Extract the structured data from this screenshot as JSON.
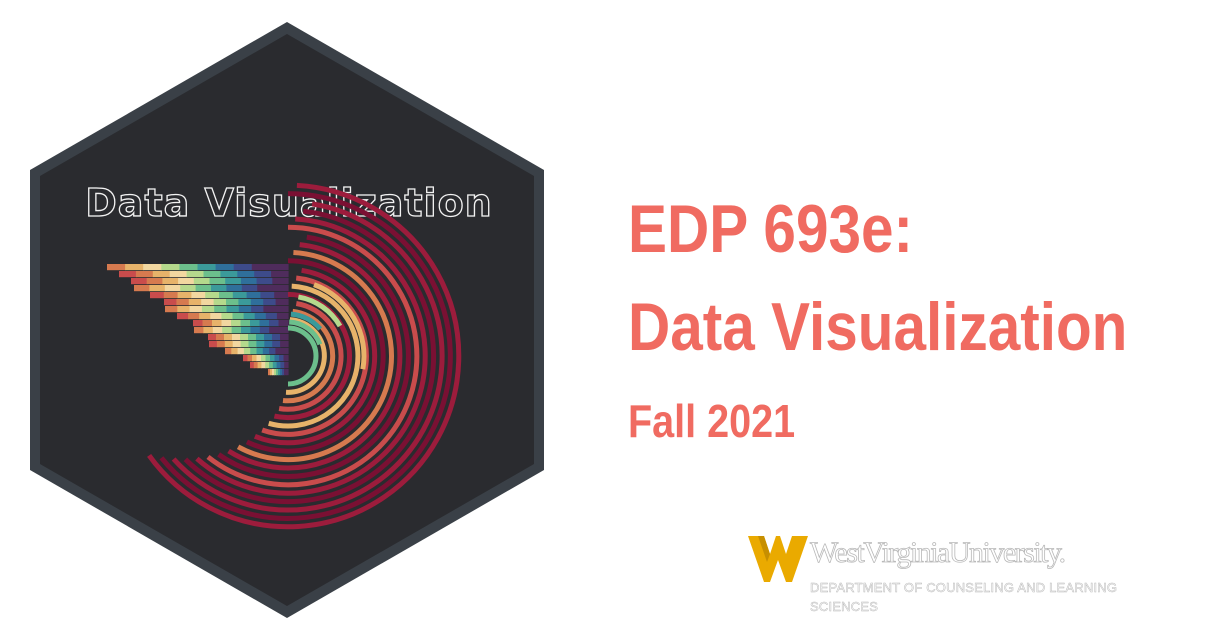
{
  "hex_sticker": {
    "title": "Data Visualization",
    "background_color": "#2a2b2f",
    "border_color": "#3a4047",
    "palette": [
      "#f2d7a0",
      "#e7b36a",
      "#d67a4f",
      "#c94c4c",
      "#9c1c3c",
      "#7a1033",
      "#4f2c5c",
      "#3d4b8a",
      "#2f6f9b",
      "#3b9a9a",
      "#6cbf8c",
      "#b5d98c"
    ]
  },
  "course": {
    "code": "EDP 693e:",
    "name": "Data Visualization",
    "term": "Fall 2021",
    "color": "#f06b61"
  },
  "logo": {
    "university": "WestVirginiaUniversity.",
    "department": "DEPARTMENT OF COUNSELING AND LEARNING SCIENCES",
    "mark_color": "#eaaa00"
  }
}
